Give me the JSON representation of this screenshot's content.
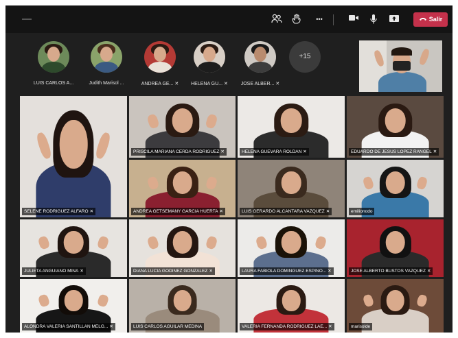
{
  "toolbar": {
    "leave_label": "Salir",
    "icons": [
      "menu-icon",
      "people-icon",
      "raise-hand-icon",
      "more-icon",
      "camera-icon",
      "mic-icon",
      "share-icon",
      "phone-icon"
    ],
    "more_glyph": "•••",
    "leave_color": "#c4314b"
  },
  "strip": {
    "participants": [
      {
        "name": "LUIS CARLOS A...",
        "muted": false
      },
      {
        "name": "Judith Marisol ...",
        "muted": false
      },
      {
        "name": "ANDREA GE...",
        "muted": true
      },
      {
        "name": "HELENA GU...",
        "muted": true
      },
      {
        "name": "JOSE ALBER...",
        "muted": true
      }
    ],
    "overflow_count": "+15"
  },
  "mic_glyph": "🎙",
  "tiles": [
    {
      "name": "SELENE RODRIGUEZ ALFARO",
      "muted": true
    },
    {
      "name": "PRISCILA MARIANA CERDA RODRIGUEZ",
      "muted": true
    },
    {
      "name": "HELENA GUEVARA ROLDAN",
      "muted": true
    },
    {
      "name": "EDUARDO DE JESUS LOPEZ RANGEL",
      "muted": true
    },
    {
      "name": "ANDREA GETSEMANY GARCIA HUERTA",
      "muted": true
    },
    {
      "name": "LUIS GERARDO ALCANTARA VAZQUEZ",
      "muted": true
    },
    {
      "name": "emilionodo",
      "muted": false
    },
    {
      "name": "JULIETA ANGUIANO MINA",
      "muted": true
    },
    {
      "name": "DIANA LUCIA GODINEZ GONZALEZ",
      "muted": true
    },
    {
      "name": "LAURA FABIOLA DOMINGUEZ ESPINO...",
      "muted": true
    },
    {
      "name": "JOSE ALBERTO BUSTOS VAZQUEZ",
      "muted": true
    },
    {
      "name": "ALONDRA VALERIA SANTILLAN MELG...",
      "muted": true
    },
    {
      "name": "LUIS CARLOS AGUILAR MEDINA",
      "muted": false
    },
    {
      "name": "VALERIA FERNANDA RODRIGUEZ LAE...",
      "muted": true
    },
    {
      "name": "marisolde",
      "muted": false
    }
  ]
}
